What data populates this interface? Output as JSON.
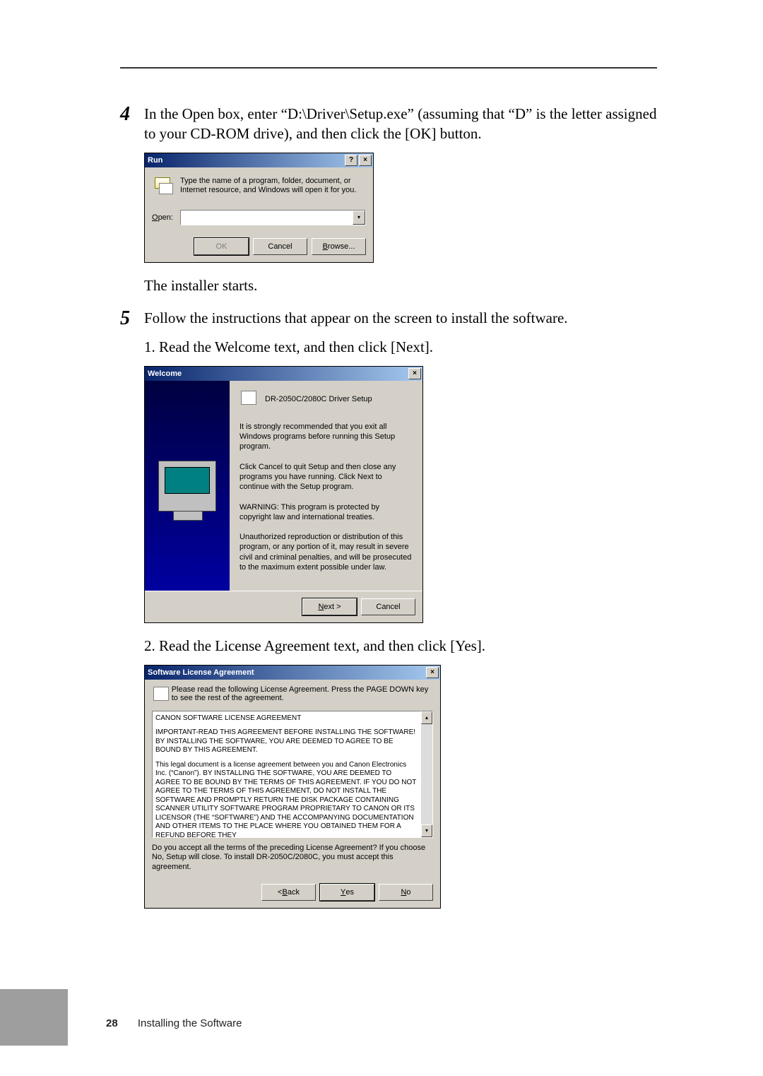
{
  "step4": {
    "num": "4",
    "text": "In the Open box, enter “D:\\Driver\\Setup.exe” (assuming that “D” is the letter assigned to your CD-ROM drive), and then click the [OK] button."
  },
  "run_dialog": {
    "title": "Run",
    "help_btn": "?",
    "close_btn": "×",
    "prompt": "Type the name of a program, folder, document, or Internet resource, and Windows will open it for you.",
    "open_label_pre": "O",
    "open_label_rest": "pen:",
    "dropdown_arrow": "▾",
    "ok": "OK",
    "cancel": "Cancel",
    "browse_pre": "B",
    "browse_rest": "rowse..."
  },
  "installer_starts": "The installer starts.",
  "step5": {
    "num": "5",
    "text": "Follow the instructions that appear on the screen to install the software.",
    "s1": "1. Read the Welcome text, and then click [Next].",
    "s2": "2. Read the License Agreement text, and then click [Yes]."
  },
  "welcome_dialog": {
    "title": "Welcome",
    "close_btn": "×",
    "product": "DR-2050C/2080C Driver Setup",
    "p1": "It is strongly recommended that you exit all Windows programs before running this Setup program.",
    "p2": "Click Cancel to quit Setup and then close any programs you have running.  Click Next to continue with the Setup program.",
    "p3": "WARNING: This program is protected by copyright law and international treaties.",
    "p4": "Unauthorized reproduction or distribution of this program, or any portion of it, may result in severe civil and criminal penalties, and will be prosecuted to the maximum extent possible under law.",
    "next_pre": "N",
    "next_rest": "ext >",
    "cancel": "Cancel"
  },
  "license_dialog": {
    "title": "Software License Agreement",
    "close_btn": "×",
    "intro": "Please read the following License Agreement.  Press the PAGE DOWN key to see the rest of the agreement.",
    "heading": "CANON SOFTWARE LICENSE AGREEMENT",
    "p1": "IMPORTANT-READ THIS AGREEMENT BEFORE  INSTALLING THE SOFTWARE! BY INSTALLING THE SOFTWARE, YOU ARE DEEMED TO AGREE TO BE BOUND BY THIS AGREEMENT.",
    "p2": "This legal document is a license agreement between you and Canon Electronics Inc. (“Canon”). BY INSTALLING THE SOFTWARE, YOU ARE DEEMED TO AGREE TO BE BOUND BY THE TERMS OF THIS AGREEMENT. IF YOU DO NOT AGREE TO THE TERMS OF THIS AGREEMENT, DO NOT INSTALL THE SOFTWARE AND PROMPTLY RETURN THE DISK PACKAGE CONTAINING SCANNER UTILITY SOFTWARE PROGRAM PROPRIETARY TO CANON OR ITS LICENSOR (THE “SOFTWARE”) AND THE ACCOMPANYING DOCUMENTATION AND OTHER ITEMS TO THE PLACE WHERE YOU OBTAINED THEM FOR A REFUND BEFORE THEY",
    "question": "Do you accept all the terms of the preceding License Agreement? If you choose No, Setup will close. To install DR-2050C/2080C, you must accept this agreement.",
    "back_pre": "< ",
    "back_u": "B",
    "back_rest": "ack",
    "yes_pre": "Y",
    "yes_rest": "es",
    "no_pre": "N",
    "no_rest": "o",
    "up": "▴",
    "down": "▾"
  },
  "footer": {
    "page": "28",
    "title": "Installing the Software"
  }
}
